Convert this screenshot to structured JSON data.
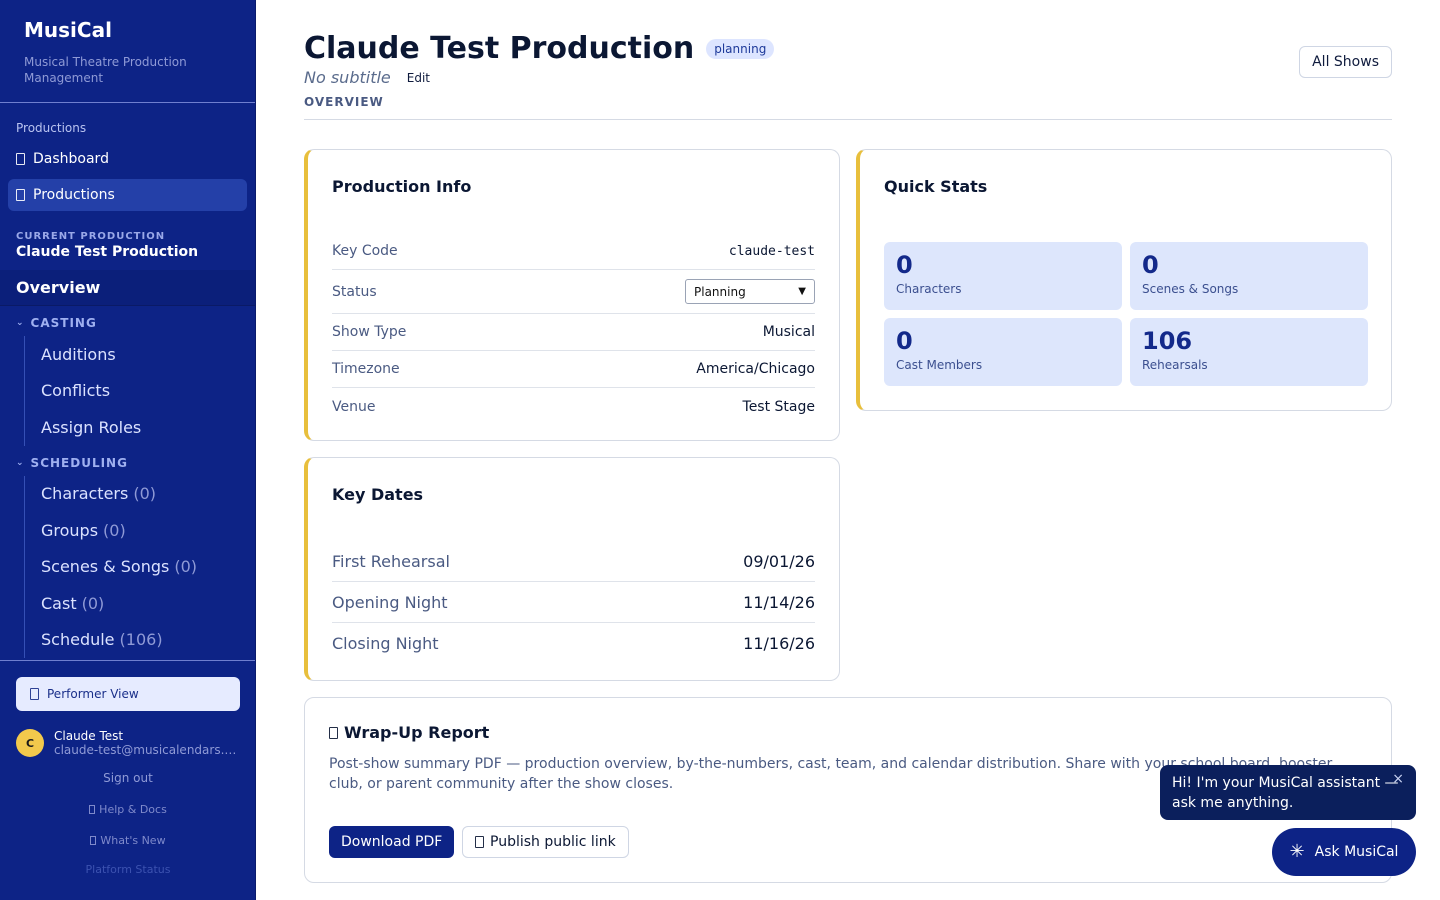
{
  "app": {
    "name": "MusiCal",
    "tagline": "Musical Theatre Production Management"
  },
  "sidebar": {
    "section_label": "Productions",
    "nav": [
      {
        "label": "Dashboard",
        "icon": "dashboard-icon"
      },
      {
        "label": "Productions",
        "icon": "productions-icon",
        "active": true
      }
    ],
    "current_label": "CURRENT PRODUCTION",
    "current_name": "Claude Test Production",
    "overview": "Overview",
    "casting": {
      "label": "CASTING",
      "items": [
        "Auditions",
        "Conflicts",
        "Assign Roles"
      ]
    },
    "scheduling": {
      "label": "SCHEDULING",
      "items": [
        {
          "label": "Characters",
          "count": "(0)"
        },
        {
          "label": "Groups",
          "count": "(0)"
        },
        {
          "label": "Scenes & Songs",
          "count": "(0)"
        },
        {
          "label": "Cast",
          "count": "(0)"
        },
        {
          "label": "Schedule",
          "count": "(106)"
        }
      ]
    },
    "performer_view": "Performer View",
    "user": {
      "initial": "C",
      "name": "Claude Test",
      "email": "claude-test@musicalendars.com"
    },
    "sign_out": "Sign out",
    "help": "Help & Docs",
    "whats_new": "What's New",
    "platform_status": "Platform Status"
  },
  "header": {
    "title": "Claude Test Production",
    "status_badge": "planning",
    "subtitle": "No subtitle",
    "edit": "Edit",
    "all_shows": "All Shows",
    "section": "OVERVIEW"
  },
  "production_info": {
    "title": "Production Info",
    "rows": [
      {
        "label": "Key Code",
        "value": "claude-test"
      },
      {
        "label": "Status",
        "value": "Planning"
      },
      {
        "label": "Show Type",
        "value": "Musical"
      },
      {
        "label": "Timezone",
        "value": "America/Chicago"
      },
      {
        "label": "Venue",
        "value": "Test Stage"
      }
    ]
  },
  "quick_stats": {
    "title": "Quick Stats",
    "stats": [
      {
        "value": "0",
        "label": "Characters"
      },
      {
        "value": "0",
        "label": "Scenes & Songs"
      },
      {
        "value": "0",
        "label": "Cast Members"
      },
      {
        "value": "106",
        "label": "Rehearsals"
      }
    ]
  },
  "key_dates": {
    "title": "Key Dates",
    "rows": [
      {
        "label": "First Rehearsal",
        "value": "09/01/26"
      },
      {
        "label": "Opening Night",
        "value": "11/14/26"
      },
      {
        "label": "Closing Night",
        "value": "11/16/26"
      }
    ]
  },
  "wrap_up": {
    "title": "Wrap-Up Report",
    "description": "Post-show summary PDF — production overview, by-the-numbers, cast, team, and calendar distribution. Share with your school board, booster club, or parent community after the show closes.",
    "download": "Download PDF",
    "publish": "Publish public link"
  },
  "assistant": {
    "greeting": "Hi! I'm your MusiCal assistant — ask me anything.",
    "close": "×",
    "button": "Ask MusiCal"
  },
  "colors": {
    "sidebar": "#0d2386",
    "accent_border": "#e8bf3c",
    "stat_bg": "#dde6fc",
    "primary_button": "#0d2386"
  }
}
